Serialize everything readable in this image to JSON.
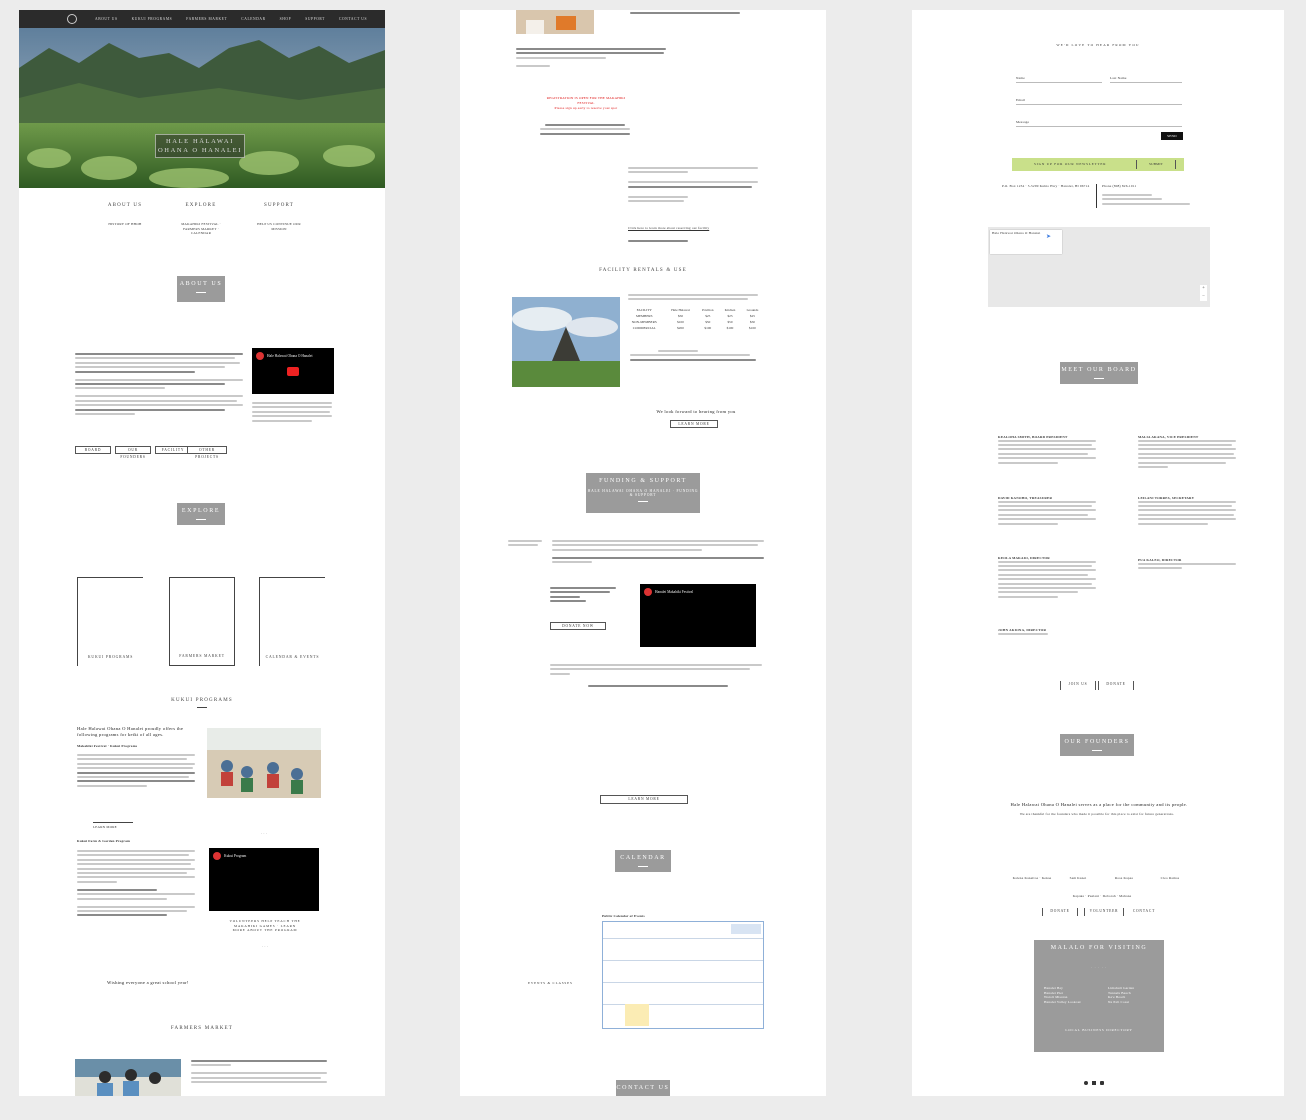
{
  "colors": {
    "accent_grey": "#9b9b9b",
    "nav_dark": "#2b2b2b",
    "map_bg": "#e8e8e8",
    "signup_green": "#c9e08a"
  },
  "nav": {
    "items": [
      "About Us",
      "Kukui Programs",
      "Farmers Market",
      "Calendar",
      "Shop",
      "Support",
      "Contact Us"
    ]
  },
  "hero": {
    "title_line1": "HALE HĀLAWAI",
    "title_line2": "OHANA O HANALEI"
  },
  "intro": {
    "cols": [
      {
        "heading": "ABOUT US",
        "link": "HISTORY OF HHOH"
      },
      {
        "heading": "EXPLORE",
        "link": "MAKAHIKI FESTIVAL · FARMERS MARKET · CALENDAR"
      },
      {
        "heading": "SUPPORT",
        "link": "HELP US CONTINUE OUR MISSION"
      }
    ]
  },
  "sections": {
    "about_us": "ABOUT US",
    "explore": "EXPLORE",
    "kukui": "KUKUI PROGRAMS",
    "farmers": "FARMERS MARKET",
    "funding": "FUNDING & SUPPORT",
    "funding_sub": "HALE HALAWAI OHANA O HANALEI · FUNDING & SUPPORT",
    "facility": "FACILITY RENTALS & USE",
    "calendar": "CALENDAR",
    "contact": "CONTACT US",
    "board": "MEET OUR BOARD",
    "founders": "OUR FOUNDERS",
    "malalo": "MALALO FOR VISITING"
  },
  "about_video": {
    "title": "Hale Halawai Ohana O Hanalei"
  },
  "about_buttons": [
    "Board",
    "Our Founders",
    "Facility",
    "Other Projects"
  ],
  "explore_cards": [
    "KUKUI PROGRAMS",
    "FARMERS MARKET",
    "CALENDAR & EVENTS"
  ],
  "kukui_text": {
    "intro": "Hale Halawai Ohana O Hanalei proudly offers the following programs for keiki of all ages.",
    "program1": "Makahiki Festival · Kukui Programs",
    "program2": "Kukui Farm & Garden Program",
    "link": "LEARN MORE",
    "video_title": "Kukui Program",
    "caption": "VOLUNTEERS HELP TEACH THE MAKAHIKI GAMES · LEARN MORE ABOUT THE PROGRAM",
    "note": "Wishing everyone a great school year!"
  },
  "p2": {
    "registration": "REGISTRATION IS OPEN FOR THE MAKAHIKI FESTIVAL",
    "registration2": "Please sign up early to reserve your spot",
    "facility_cta": "Click here to learn more about reserving our facility",
    "facility_table_headers": [
      "FACILITY",
      "Hale Halawai",
      "Pavilion",
      "Kitchen",
      "Grounds"
    ],
    "facility_table_rows": [
      [
        "MEMBERS",
        "$50",
        "$25",
        "$25",
        "$25"
      ],
      [
        "NON-MEMBERS",
        "$100",
        "$50",
        "$50",
        "$50"
      ],
      [
        "COMMERCIAL",
        "$200",
        "$100",
        "$100",
        "$100"
      ]
    ],
    "facility_footer": "We look forward to hearing from you",
    "funding_video": "Hanalei Makahiki Festival",
    "funding_button": "DONATE NOW",
    "calendar_title": "Public Calendar of Events",
    "calendar_label": "EVENTS & CLASSES",
    "spacer_button": "LEARN MORE"
  },
  "p3": {
    "contact_header": "WE'D LOVE TO HEAR FROM YOU",
    "form_fields": [
      "Name",
      "Email",
      "Message"
    ],
    "form_placeholder": "Last Name",
    "submit": "SEND",
    "newsletter": "SIGN UP FOR OUR NEWSLETTER",
    "newsletter_btn": "SUBMIT",
    "address": "P.O. Box 1234 · 5-5299 Kuhio Hwy · Hanalei, HI 96714",
    "phone": "Phone (808) 826-1011",
    "map_label": "Hale Halawai Ohana O Hanalei",
    "board_names": [
      "KEALOHA SMITH, BOARD PRESIDENT",
      "MALIA AKANA, VICE PRESIDENT",
      "DAVID KANOHO, TREASURER",
      "LEILANI TORRES, SECRETARY",
      "KEOLA MAKAIO, DIRECTOR",
      "PUA KALEO, DIRECTOR",
      "JOHN AKIONA, DIRECTOR"
    ],
    "board_buttons": [
      "JOIN US",
      "DONATE"
    ],
    "founders_text": "Hale Halawai Ohana O Hanalei serves as a place for the community and its people.",
    "founders_text2": "We are thankful for the founders who made it possible for this place to exist for future generations.",
    "founder_names": [
      "Kalena Kaneiloa · Kekaa",
      "Sam Kanei",
      "Rosa Kapaa",
      "Cleo Ramos"
    ],
    "founder_links": [
      "Kapaka · Pualani · Deborah · Mahana"
    ],
    "founder_buttons": [
      "DONATE",
      "VOLUNTEER",
      "CONTACT"
    ],
    "malalo_items": [
      "Hanalei Bay",
      "Hanalei Pier",
      "Waioli Mission",
      "Hanalei Valley Lookout",
      "Limahuli Garden",
      "Tunnels Beach",
      "Ke'e Beach",
      "Na Pali Coast"
    ],
    "malalo_sub": "LOCAL BUSINESS DIRECTORY"
  }
}
